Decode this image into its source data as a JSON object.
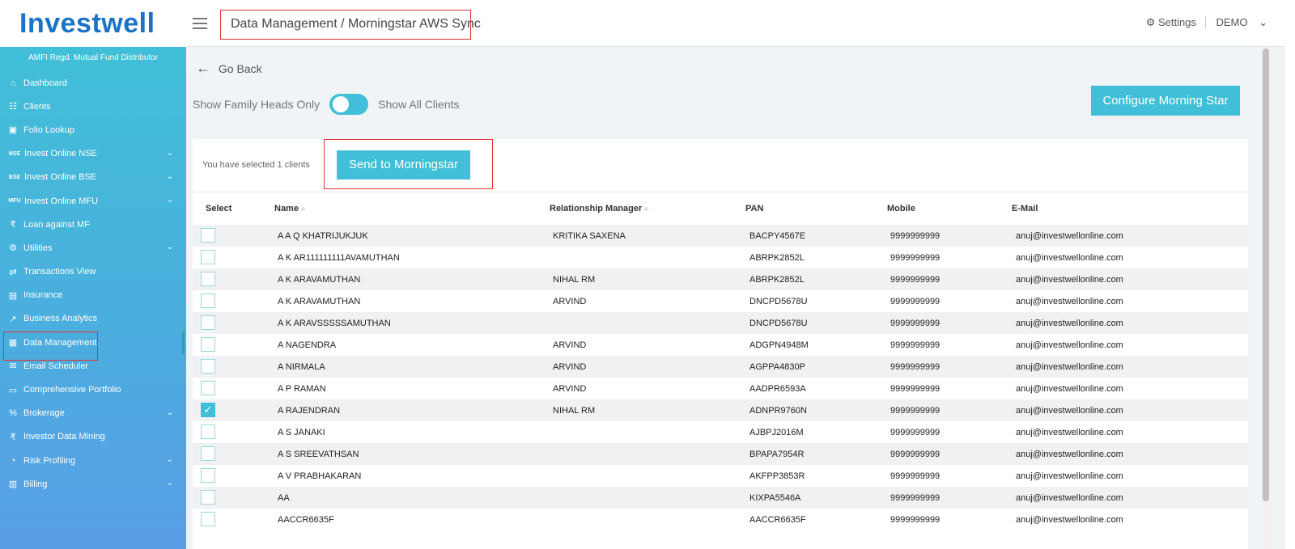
{
  "brand": {
    "logo": "Investwell",
    "subtitle": "AMFI Regd. Mutual Fund Distributor"
  },
  "header": {
    "breadcrumb": "Data Management / Morningstar AWS Sync",
    "settings_label": "Settings",
    "user_label": "DEMO"
  },
  "sidebar": {
    "items": [
      {
        "label": "Dashboard",
        "icon": "home-icon",
        "glyph": "⌂",
        "chevron": false
      },
      {
        "label": "Clients",
        "icon": "users-icon",
        "glyph": "☷",
        "chevron": false
      },
      {
        "label": "Folio Lookup",
        "icon": "folio-icon",
        "glyph": "▣",
        "chevron": false
      },
      {
        "label": "Invest Online NSE",
        "icon": "nse-icon",
        "glyph": "NSE",
        "chevron": true
      },
      {
        "label": "Invest Online BSE",
        "icon": "bse-icon",
        "glyph": "BSE",
        "chevron": true
      },
      {
        "label": "Invest Online MFU",
        "icon": "mfu-icon",
        "glyph": "MFU",
        "chevron": true
      },
      {
        "label": "Loan against MF",
        "icon": "loan-icon",
        "glyph": "₹",
        "chevron": false
      },
      {
        "label": "Utilities",
        "icon": "utilities-icon",
        "glyph": "⚙",
        "chevron": true
      },
      {
        "label": "Transactions View",
        "icon": "transactions-icon",
        "glyph": "⇄",
        "chevron": false
      },
      {
        "label": "Insurance",
        "icon": "insurance-icon",
        "glyph": "▤",
        "chevron": false
      },
      {
        "label": "Business Analytics",
        "icon": "analytics-icon",
        "glyph": "↗",
        "chevron": false
      },
      {
        "label": "Data Management",
        "icon": "database-icon",
        "glyph": "▦",
        "chevron": false,
        "active": true
      },
      {
        "label": "Email Scheduler",
        "icon": "email-icon",
        "glyph": "✉",
        "chevron": false
      },
      {
        "label": "Comprehensive Portfolio",
        "icon": "portfolio-icon",
        "glyph": "▭",
        "chevron": false
      },
      {
        "label": "Brokerage",
        "icon": "brokerage-icon",
        "glyph": "%",
        "chevron": true
      },
      {
        "label": "Investor Data Mining",
        "icon": "mining-icon",
        "glyph": "₹",
        "chevron": false
      },
      {
        "label": "Risk Profiling",
        "icon": "risk-icon",
        "glyph": "◔",
        "chevron": true
      },
      {
        "label": "Billing",
        "icon": "billing-icon",
        "glyph": "▥",
        "chevron": true
      }
    ]
  },
  "main": {
    "go_back": "Go Back",
    "toggle_left": "Show Family Heads Only",
    "toggle_right": "Show All Clients",
    "configure_button": "Configure Morning Star",
    "selected_text": "You have selected 1 clients",
    "send_button": "Send to Morningstar"
  },
  "table": {
    "headers": {
      "select": "Select",
      "name": "Name",
      "rm": "Relationship Manager",
      "pan": "PAN",
      "mobile": "Mobile",
      "email": "E-Mail"
    },
    "rows": [
      {
        "checked": false,
        "name": "A A Q KHATRIJUKJUK",
        "rm": "KRITIKA SAXENA",
        "pan": "BACPY4567E",
        "mobile": "9999999999",
        "email": "anuj@investwellonline.com"
      },
      {
        "checked": false,
        "name": "A K AR111111111AVAMUTHAN",
        "rm": "",
        "pan": "ABRPK2852L",
        "mobile": "9999999999",
        "email": "anuj@investwellonline.com"
      },
      {
        "checked": false,
        "name": "A K ARAVAMUTHAN",
        "rm": "NIHAL RM",
        "pan": "ABRPK2852L",
        "mobile": "9999999999",
        "email": "anuj@investwellonline.com"
      },
      {
        "checked": false,
        "name": "A K ARAVAMUTHAN",
        "rm": "ARVIND",
        "pan": "DNCPD5678U",
        "mobile": "9999999999",
        "email": "anuj@investwellonline.com"
      },
      {
        "checked": false,
        "name": "A K ARAVSSSSSAMUTHAN",
        "rm": "",
        "pan": "DNCPD5678U",
        "mobile": "9999999999",
        "email": "anuj@investwellonline.com"
      },
      {
        "checked": false,
        "name": "A NAGENDRA",
        "rm": "ARVIND",
        "pan": "ADGPN4948M",
        "mobile": "9999999999",
        "email": "anuj@investwellonline.com"
      },
      {
        "checked": false,
        "name": "A NIRMALA",
        "rm": "ARVIND",
        "pan": "AGPPA4830P",
        "mobile": "9999999999",
        "email": "anuj@investwellonline.com"
      },
      {
        "checked": false,
        "name": "A P RAMAN",
        "rm": "ARVIND",
        "pan": "AADPR6593A",
        "mobile": "9999999999",
        "email": "anuj@investwellonline.com"
      },
      {
        "checked": true,
        "name": "A RAJENDRAN",
        "rm": "NIHAL RM",
        "pan": "ADNPR9760N",
        "mobile": "9999999999",
        "email": "anuj@investwellonline.com"
      },
      {
        "checked": false,
        "name": "A S JANAKI",
        "rm": "",
        "pan": "AJBPJ2016M",
        "mobile": "9999999999",
        "email": "anuj@investwellonline.com"
      },
      {
        "checked": false,
        "name": "A S SREEVATHSAN",
        "rm": "",
        "pan": "BPAPA7954R",
        "mobile": "9999999999",
        "email": "anuj@investwellonline.com"
      },
      {
        "checked": false,
        "name": "A V PRABHAKARAN",
        "rm": "",
        "pan": "AKFPP3853R",
        "mobile": "9999999999",
        "email": "anuj@investwellonline.com"
      },
      {
        "checked": false,
        "name": "AA",
        "rm": "",
        "pan": "KIXPA5546A",
        "mobile": "9999999999",
        "email": "anuj@investwellonline.com"
      },
      {
        "checked": false,
        "name": "AACCR6635F",
        "rm": "",
        "pan": "AACCR6635F",
        "mobile": "9999999999",
        "email": "anuj@investwellonline.com"
      }
    ]
  },
  "colors": {
    "accent": "#41bfd8",
    "brand": "#1a73c6",
    "highlight": "#e23434"
  }
}
